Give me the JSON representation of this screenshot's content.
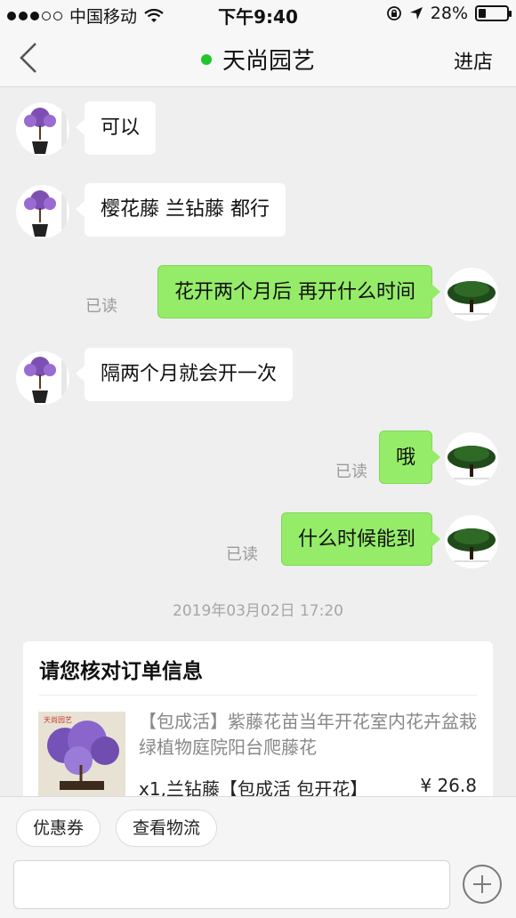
{
  "status_bar": {
    "carrier": "中国移动",
    "time": "下午9:40",
    "battery": "28%",
    "battery_level": 0.28
  },
  "nav": {
    "title": "天尚园艺",
    "store_label": "进店",
    "online_color": "#1fc62d"
  },
  "messages": [
    {
      "from": "shop",
      "text": "可以"
    },
    {
      "from": "shop",
      "text": "樱花藤 兰钻藤 都行"
    },
    {
      "from": "me",
      "text": "花开两个月后 再开什么时间",
      "status": "已读"
    },
    {
      "from": "shop",
      "text": "隔两个月就会开一次"
    },
    {
      "from": "me",
      "text": "哦",
      "status": "已读"
    },
    {
      "from": "me",
      "text": "什么时候能到",
      "status": "已读"
    }
  ],
  "timestamp": "2019年03月02日 17:20",
  "order": {
    "title": "请您核对订单信息",
    "product_name": "【包成活】紫藤花苗当年开花室内花卉盆栽绿植物庭院阳台爬藤花",
    "variant": "x1,兰钻藤【包成活 包开花】",
    "price": "¥ 26.8"
  },
  "actions": {
    "coupon_label": "优惠券",
    "logistics_label": "查看物流"
  },
  "colors": {
    "outgoing_bubble": "#95ec69",
    "incoming_bubble": "#ffffff",
    "background": "#efefef"
  }
}
